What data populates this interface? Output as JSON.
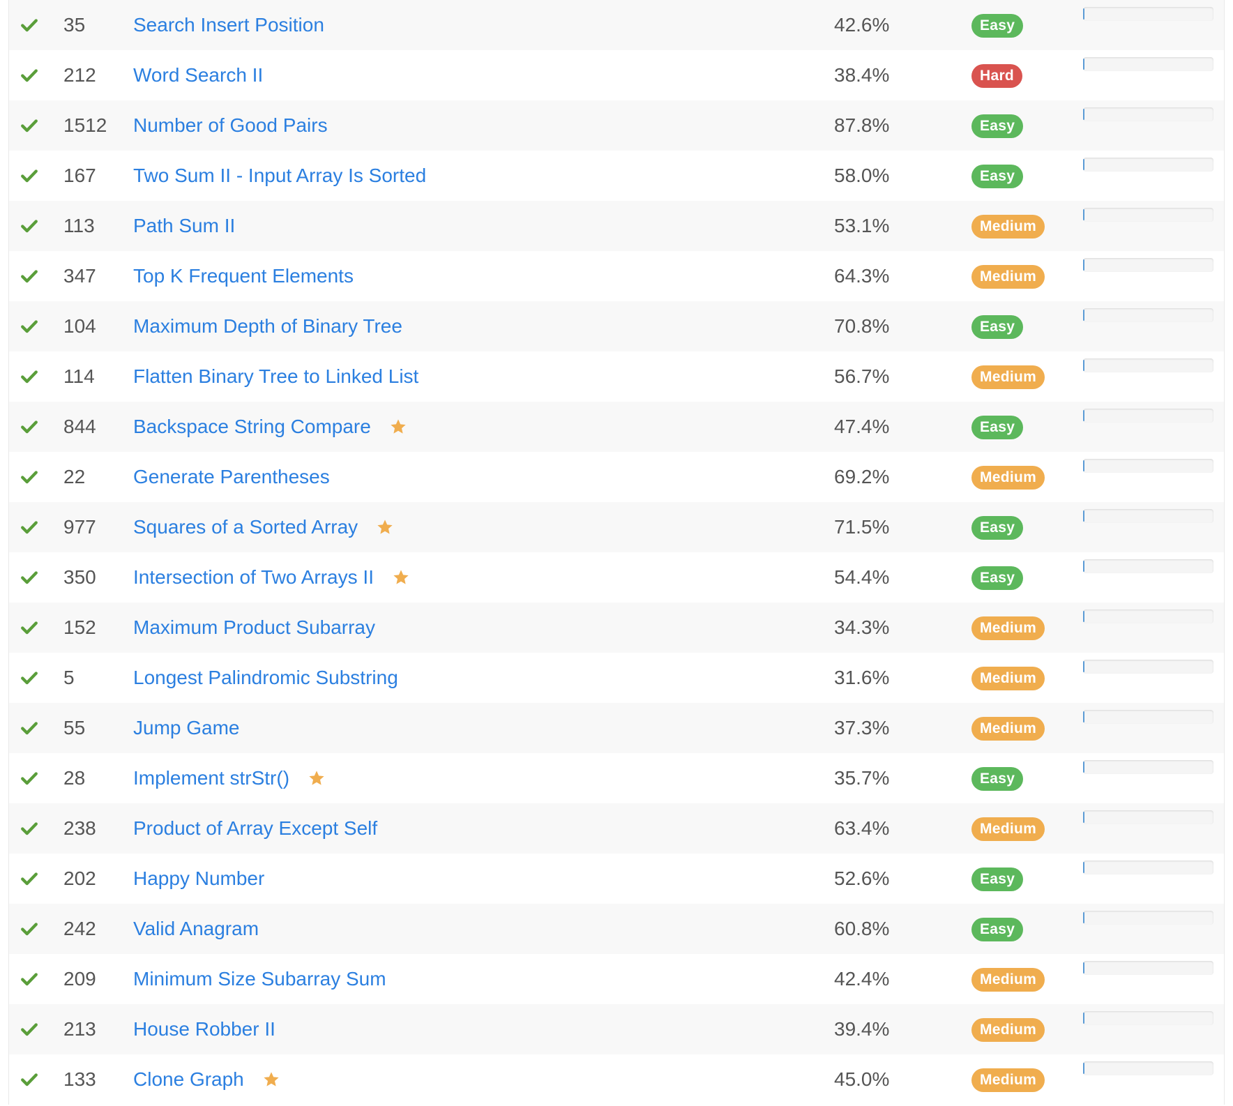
{
  "colors": {
    "link": "#2b7fe0",
    "check": "#5a9e3a",
    "star": "#f0ad4e",
    "easy": "#5cb85c",
    "medium": "#f0ad4e",
    "hard": "#d9534f"
  },
  "problems": [
    {
      "id": "35",
      "title": "Search Insert Position",
      "rate": "42.6%",
      "difficulty": "Easy",
      "starred": false
    },
    {
      "id": "212",
      "title": "Word Search II",
      "rate": "38.4%",
      "difficulty": "Hard",
      "starred": false
    },
    {
      "id": "1512",
      "title": "Number of Good Pairs",
      "rate": "87.8%",
      "difficulty": "Easy",
      "starred": false
    },
    {
      "id": "167",
      "title": "Two Sum II - Input Array Is Sorted",
      "rate": "58.0%",
      "difficulty": "Easy",
      "starred": false
    },
    {
      "id": "113",
      "title": "Path Sum II",
      "rate": "53.1%",
      "difficulty": "Medium",
      "starred": false
    },
    {
      "id": "347",
      "title": "Top K Frequent Elements",
      "rate": "64.3%",
      "difficulty": "Medium",
      "starred": false
    },
    {
      "id": "104",
      "title": "Maximum Depth of Binary Tree",
      "rate": "70.8%",
      "difficulty": "Easy",
      "starred": false
    },
    {
      "id": "114",
      "title": "Flatten Binary Tree to Linked List",
      "rate": "56.7%",
      "difficulty": "Medium",
      "starred": false
    },
    {
      "id": "844",
      "title": "Backspace String Compare",
      "rate": "47.4%",
      "difficulty": "Easy",
      "starred": true
    },
    {
      "id": "22",
      "title": "Generate Parentheses",
      "rate": "69.2%",
      "difficulty": "Medium",
      "starred": false
    },
    {
      "id": "977",
      "title": "Squares of a Sorted Array",
      "rate": "71.5%",
      "difficulty": "Easy",
      "starred": true
    },
    {
      "id": "350",
      "title": "Intersection of Two Arrays II",
      "rate": "54.4%",
      "difficulty": "Easy",
      "starred": true
    },
    {
      "id": "152",
      "title": "Maximum Product Subarray",
      "rate": "34.3%",
      "difficulty": "Medium",
      "starred": false
    },
    {
      "id": "5",
      "title": "Longest Palindromic Substring",
      "rate": "31.6%",
      "difficulty": "Medium",
      "starred": false
    },
    {
      "id": "55",
      "title": "Jump Game",
      "rate": "37.3%",
      "difficulty": "Medium",
      "starred": false
    },
    {
      "id": "28",
      "title": "Implement strStr()",
      "rate": "35.7%",
      "difficulty": "Easy",
      "starred": true
    },
    {
      "id": "238",
      "title": "Product of Array Except Self",
      "rate": "63.4%",
      "difficulty": "Medium",
      "starred": false
    },
    {
      "id": "202",
      "title": "Happy Number",
      "rate": "52.6%",
      "difficulty": "Easy",
      "starred": false
    },
    {
      "id": "242",
      "title": "Valid Anagram",
      "rate": "60.8%",
      "difficulty": "Easy",
      "starred": false
    },
    {
      "id": "209",
      "title": "Minimum Size Subarray Sum",
      "rate": "42.4%",
      "difficulty": "Medium",
      "starred": false
    },
    {
      "id": "213",
      "title": "House Robber II",
      "rate": "39.4%",
      "difficulty": "Medium",
      "starred": false
    },
    {
      "id": "133",
      "title": "Clone Graph",
      "rate": "45.0%",
      "difficulty": "Medium",
      "starred": true
    }
  ]
}
